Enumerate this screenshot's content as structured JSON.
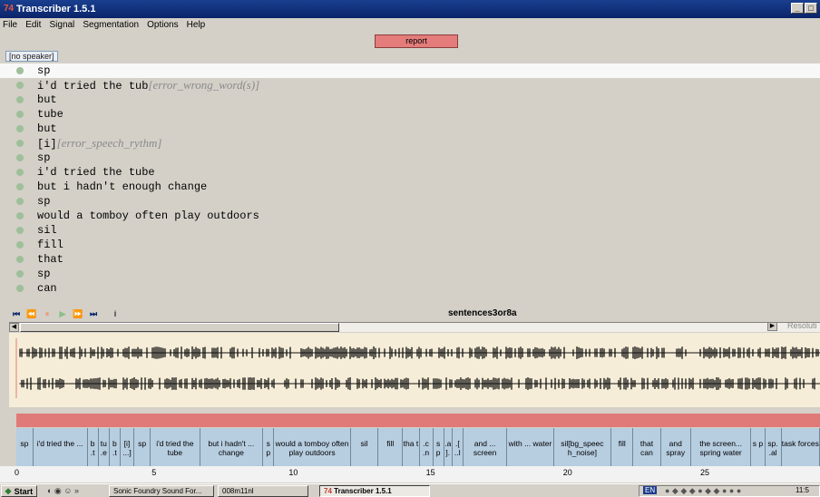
{
  "window": {
    "title": "Transcriber 1.5.1",
    "app_icon": "74"
  },
  "menu": [
    "File",
    "Edit",
    "Signal",
    "Segmentation",
    "Options",
    "Help"
  ],
  "report_button": "report",
  "speaker": "[no speaker]",
  "transcript": [
    {
      "text": "sp",
      "err": ""
    },
    {
      "text": "i'd tried the tub",
      "err": "[error_wrong_word(s)]"
    },
    {
      "text": "but",
      "err": ""
    },
    {
      "text": "tube",
      "err": ""
    },
    {
      "text": "but",
      "err": ""
    },
    {
      "text": "[i]",
      "err": "[error_speech_rythm]"
    },
    {
      "text": "sp",
      "err": ""
    },
    {
      "text": "i'd tried the tube",
      "err": ""
    },
    {
      "text": "but i hadn't enough change",
      "err": ""
    },
    {
      "text": "sp",
      "err": ""
    },
    {
      "text": "would a tomboy often play outdoors",
      "err": ""
    },
    {
      "text": "sil",
      "err": ""
    },
    {
      "text": "fill",
      "err": ""
    },
    {
      "text": "that",
      "err": ""
    },
    {
      "text": "sp",
      "err": ""
    },
    {
      "text": "can",
      "err": ""
    }
  ],
  "player": {
    "filename": "sentences3or8a"
  },
  "resolution_label": "Resoluti",
  "segments": [
    {
      "label": "sp",
      "start": 0,
      "end": 0.62
    },
    {
      "label": "i'd tried the ...",
      "start": 0.62,
      "end": 2.6
    },
    {
      "label": "b .t",
      "start": 2.6,
      "end": 3.0
    },
    {
      "label": "tu .e",
      "start": 3.0,
      "end": 3.4
    },
    {
      "label": "b .t",
      "start": 3.4,
      "end": 3.8
    },
    {
      "label": "[i] ...]",
      "start": 3.8,
      "end": 4.3
    },
    {
      "label": "sp",
      "start": 4.3,
      "end": 4.9
    },
    {
      "label": "i'd tried the tube",
      "start": 4.9,
      "end": 6.7
    },
    {
      "label": "but i hadn't ... change",
      "start": 6.7,
      "end": 9.0
    },
    {
      "label": "s p",
      "start": 9.0,
      "end": 9.4
    },
    {
      "label": "would a tomboy often play outdoors",
      "start": 9.4,
      "end": 12.2
    },
    {
      "label": "sil",
      "start": 12.2,
      "end": 13.2
    },
    {
      "label": "fill",
      "start": 13.2,
      "end": 14.1
    },
    {
      "label": "tha t",
      "start": 14.1,
      "end": 14.7
    },
    {
      "label": ".c .n",
      "start": 14.7,
      "end": 15.2
    },
    {
      "label": "s p",
      "start": 15.2,
      "end": 15.6
    },
    {
      "label": ".a ].",
      "start": 15.6,
      "end": 15.9
    },
    {
      "label": ".[ ..l",
      "start": 15.9,
      "end": 16.3
    },
    {
      "label": "and ... screen",
      "start": 16.3,
      "end": 17.9
    },
    {
      "label": "with ... water",
      "start": 17.9,
      "end": 19.6
    },
    {
      "label": "sil[bg_speec h_noise]",
      "start": 19.6,
      "end": 21.7
    },
    {
      "label": "fill",
      "start": 21.7,
      "end": 22.5
    },
    {
      "label": "that can",
      "start": 22.5,
      "end": 23.5
    },
    {
      "label": "and spray",
      "start": 23.5,
      "end": 24.6
    },
    {
      "label": "the screen... spring water",
      "start": 24.6,
      "end": 26.8
    },
    {
      "label": "s p",
      "start": 26.8,
      "end": 27.3
    },
    {
      "label": "sp. .al",
      "start": 27.3,
      "end": 27.9
    },
    {
      "label": "task forces",
      "start": 27.9,
      "end": 29.3
    }
  ],
  "axis": {
    "ticks": [
      "0",
      "5",
      "10",
      "15",
      "20",
      "25"
    ],
    "tick_values": [
      0,
      5,
      10,
      15,
      20,
      25
    ],
    "max": 29.3
  },
  "taskbar": {
    "start": "Start",
    "items": [
      "Sonic Foundry Sound For...",
      "008m11nl",
      "Transcriber 1.5.1"
    ],
    "lang": "EN",
    "clock": "11:5"
  }
}
